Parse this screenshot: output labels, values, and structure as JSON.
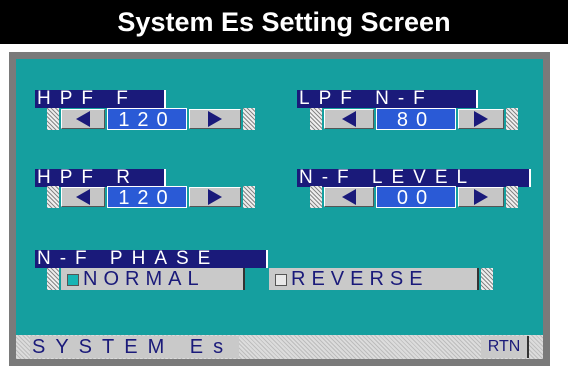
{
  "title": "System Es Setting Screen",
  "colors": {
    "screen_bg": "#159f9f",
    "label_bg": "#1a1a7a",
    "value_bg": "#2a5ad6",
    "button_bg": "#c9c9c9"
  },
  "controls": {
    "hpf_f": {
      "label": "HPF F",
      "value": "120"
    },
    "lpf_nf": {
      "label": "LPF N-F",
      "value": "80"
    },
    "hpf_r": {
      "label": "HPF R",
      "value": "120"
    },
    "nf_level": {
      "label": "N-F LEVEL",
      "value": "00"
    }
  },
  "nf_phase": {
    "label": "N-F PHASE",
    "options": [
      {
        "label": "NORMAL",
        "selected": true
      },
      {
        "label": "REVERSE",
        "selected": false
      }
    ]
  },
  "bottom": {
    "screen_name": "SYSTEM Es",
    "return_label": "RTN"
  },
  "icons": {
    "decrement": "left-triangle-icon",
    "increment": "right-triangle-icon"
  }
}
